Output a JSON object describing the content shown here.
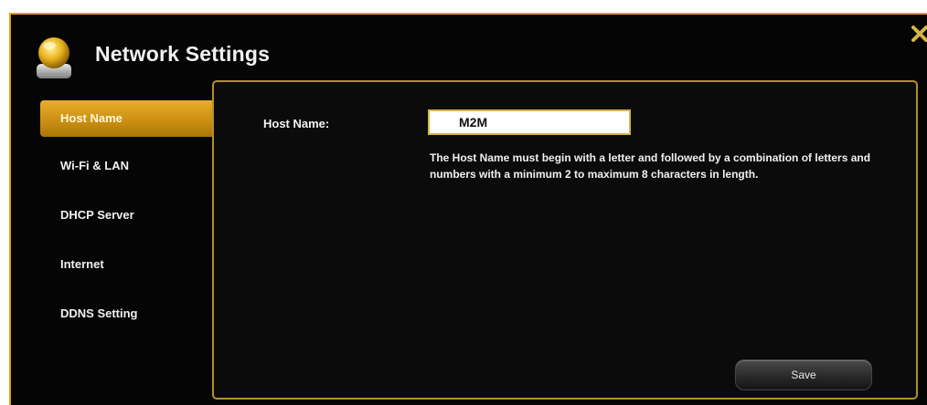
{
  "window": {
    "title": "Network Settings",
    "close_glyph": "✕",
    "icons": {
      "app": "network-drive-icon",
      "close": "close-icon"
    },
    "colors": {
      "accent": "#d9a21b",
      "background": "#050505"
    }
  },
  "sidebar": {
    "items": [
      {
        "label": "Host Name",
        "active": true
      },
      {
        "label": "Wi-Fi & LAN",
        "active": false
      },
      {
        "label": "DHCP Server",
        "active": false
      },
      {
        "label": "Internet",
        "active": false
      },
      {
        "label": "DDNS Setting",
        "active": false
      }
    ]
  },
  "host_name_form": {
    "label": "Host Name:",
    "value": "M2M",
    "help_text": "The Host Name must begin with a letter and followed by a combination of letters and numbers with a minimum 2 to maximum 8 characters in length.",
    "save_label": "Save"
  }
}
